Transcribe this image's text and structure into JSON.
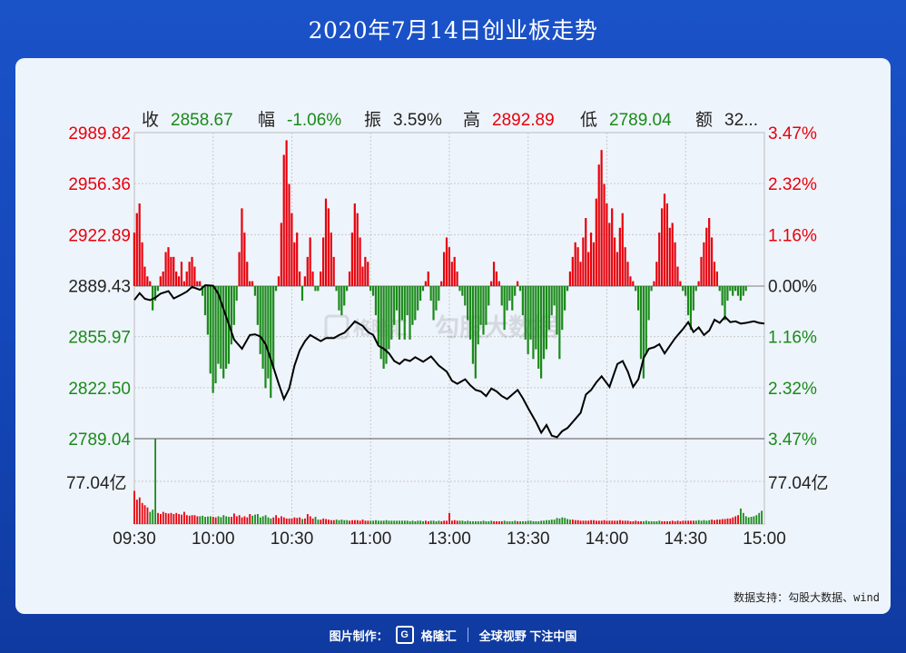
{
  "header": {
    "title": "2020年7月14日创业板走势"
  },
  "stats": {
    "close_label": "收",
    "close_value": "2858.67",
    "change_label": "幅",
    "change_value": "-1.06%",
    "amplitude_label": "振",
    "amplitude_value": "3.59%",
    "high_label": "高",
    "high_value": "2892.89",
    "low_label": "低",
    "low_value": "2789.04",
    "amount_label": "额",
    "amount_value": "32..."
  },
  "watermark": {
    "logo_text": "格隆汇",
    "text": "勾股大数据"
  },
  "source_note": "数据支持：勾股大数据、wind",
  "footer": {
    "made_by": "图片制作：",
    "logo_text": "格隆汇",
    "slogan": "全球视野 下注中国"
  },
  "colors": {
    "up": "#e8000b",
    "down": "#1a8a1a",
    "neutral": "#222222",
    "grid": "#c9c9c9"
  },
  "chart_data": {
    "type": "line",
    "prev_close": 2889.43,
    "price_ticks": [
      "2989.82",
      "2956.36",
      "2922.89",
      "2889.43",
      "2855.97",
      "2822.50",
      "2789.04"
    ],
    "pct_ticks": [
      "3.47%",
      "2.32%",
      "1.16%",
      "0.00%",
      "1.16%",
      "2.32%",
      "3.47%"
    ],
    "ylim": [
      2789.04,
      2989.82
    ],
    "x_ticks": [
      "09:30",
      "10:00",
      "10:30",
      "11:00",
      "13:00",
      "13:30",
      "14:00",
      "14:30",
      "15:00"
    ],
    "x_minutes": [
      0,
      30,
      60,
      90,
      120,
      150,
      180,
      210,
      240
    ],
    "volume_label_left": "77.04亿",
    "volume_label_right": "77.04亿",
    "price_series": {
      "minutes": [
        0,
        2,
        4,
        6,
        8,
        10,
        13,
        15,
        18,
        20,
        22,
        25,
        27,
        30,
        32,
        34,
        36,
        38,
        41,
        44,
        46,
        48,
        50,
        52,
        55,
        57,
        59,
        61,
        63,
        65,
        67,
        69,
        71,
        73,
        76,
        78,
        80,
        82,
        84,
        87,
        89,
        91,
        93,
        95,
        97,
        99,
        101,
        103,
        105,
        107,
        110,
        113,
        116,
        119,
        121,
        123,
        126,
        128,
        130,
        132,
        134,
        136,
        138,
        140,
        142,
        144,
        146,
        148,
        150,
        153,
        155,
        157,
        159,
        161,
        163,
        165,
        167,
        170,
        172,
        174,
        176,
        178,
        181,
        184,
        186,
        188,
        190,
        192,
        194,
        196,
        198,
        200,
        202,
        204,
        206,
        209,
        211,
        213,
        215,
        217,
        219,
        221,
        223,
        225,
        227,
        229,
        231,
        233,
        236,
        238,
        240
      ],
      "values": [
        2880.0,
        2884.5,
        2880.8,
        2879.9,
        2881.5,
        2884.2,
        2885.8,
        2881.0,
        2883.6,
        2885.5,
        2888.6,
        2886.7,
        2889.7,
        2889.4,
        2884.0,
        2874.0,
        2864.0,
        2854.0,
        2848.0,
        2857.0,
        2857.5,
        2856.0,
        2851.0,
        2841.0,
        2825.0,
        2815.0,
        2822.0,
        2837.0,
        2847.0,
        2853.0,
        2857.0,
        2855.0,
        2853.0,
        2855.0,
        2855.0,
        2857.0,
        2858.5,
        2862.0,
        2866.0,
        2863.0,
        2859.0,
        2857.0,
        2850.0,
        2848.0,
        2845.0,
        2840.0,
        2838.0,
        2841.0,
        2840.0,
        2842.5,
        2839.5,
        2843.0,
        2837.0,
        2833.0,
        2827.0,
        2825.0,
        2828.0,
        2824.0,
        2821.0,
        2820.0,
        2817.0,
        2822.0,
        2820.0,
        2817.0,
        2815.0,
        2818.0,
        2821.0,
        2815.5,
        2809.0,
        2800.0,
        2793.0,
        2798.0,
        2791.0,
        2790.0,
        2794.0,
        2796.0,
        2800.0,
        2806.0,
        2818.0,
        2821.0,
        2826.0,
        2830.0,
        2823.0,
        2838.0,
        2840.0,
        2833.0,
        2823.0,
        2828.0,
        2842.0,
        2848.0,
        2849.0,
        2851.0,
        2845.0,
        2850.0,
        2855.0,
        2861.0,
        2865.5,
        2859.0,
        2862.0,
        2857.0,
        2860.0,
        2867.0,
        2865.0,
        2869.0,
        2865.5,
        2866.0,
        2864.5,
        2865.0,
        2866.0,
        2865.0,
        2864.5
      ]
    },
    "breadth_series": {
      "minutes": [
        0,
        1,
        2,
        3,
        4,
        5,
        6,
        7,
        8,
        9,
        10,
        11,
        12,
        13,
        14,
        15,
        16,
        17,
        18,
        19,
        20,
        21,
        22,
        23,
        24,
        25,
        26,
        27,
        28,
        29,
        30,
        31,
        32,
        33,
        34,
        35,
        36,
        37,
        38,
        39,
        40,
        41,
        42,
        43,
        44,
        45,
        46,
        47,
        48,
        49,
        50,
        51,
        52,
        53,
        54,
        55,
        56,
        57,
        58,
        59,
        60,
        61,
        62,
        63,
        64,
        65,
        66,
        67,
        68,
        69,
        70,
        71,
        72,
        73,
        74,
        75,
        76,
        77,
        78,
        79,
        80,
        81,
        82,
        83,
        84,
        85,
        86,
        87,
        88,
        89,
        90,
        91,
        92,
        93,
        94,
        95,
        96,
        97,
        98,
        99,
        100,
        101,
        102,
        103,
        104,
        105,
        106,
        107,
        108,
        109,
        110,
        111,
        112,
        113,
        114,
        115,
        116,
        117,
        118,
        119,
        120,
        121,
        122,
        123,
        124,
        125,
        126,
        127,
        128,
        129,
        130,
        131,
        132,
        133,
        134,
        135,
        136,
        137,
        138,
        139,
        140,
        141,
        142,
        143,
        144,
        145,
        146,
        147,
        148,
        149,
        150,
        151,
        152,
        153,
        154,
        155,
        156,
        157,
        158,
        159,
        160,
        161,
        162,
        163,
        164,
        165,
        166,
        167,
        168,
        169,
        170,
        171,
        172,
        173,
        174,
        175,
        176,
        177,
        178,
        179,
        180,
        181,
        182,
        183,
        184,
        185,
        186,
        187,
        188,
        189,
        190,
        191,
        192,
        193,
        194,
        195,
        196,
        197,
        198,
        199,
        200,
        201,
        202,
        203,
        204,
        205,
        206,
        207,
        208,
        209,
        210,
        211,
        212,
        213,
        214,
        215,
        216,
        217,
        218,
        219,
        220,
        221,
        222,
        223,
        224,
        225,
        226,
        227,
        228,
        229,
        230,
        231,
        232,
        233,
        234,
        235,
        236,
        237,
        238,
        239
      ],
      "values": [
        0.55,
        0.75,
        0.85,
        0.45,
        0.2,
        0.1,
        0.05,
        -0.25,
        -0.15,
        -0.05,
        0.1,
        0.15,
        0.35,
        0.4,
        0.3,
        0.3,
        0.15,
        0.1,
        0.25,
        0.05,
        0.15,
        0.25,
        0.3,
        0.2,
        0.05,
        0.05,
        -0.1,
        -0.3,
        -0.5,
        -0.9,
        -1.1,
        -1.0,
        -0.8,
        -0.85,
        -0.95,
        -0.85,
        -0.8,
        -0.6,
        -0.4,
        -0.15,
        0.35,
        0.8,
        0.55,
        0.25,
        0.05,
        0.05,
        -0.1,
        -0.4,
        -0.7,
        -0.85,
        -1.05,
        -0.95,
        -1.15,
        -0.85,
        -0.05,
        0.1,
        0.65,
        1.35,
        1.5,
        1.05,
        0.75,
        0.45,
        0.55,
        0.15,
        -0.15,
        0.1,
        0.3,
        0.5,
        0.15,
        -0.05,
        -0.05,
        0.15,
        0.5,
        0.9,
        0.8,
        0.55,
        0.3,
        -0.05,
        -0.25,
        -0.3,
        -0.2,
        -0.05,
        0.15,
        0.55,
        0.85,
        0.75,
        0.5,
        0.2,
        0.3,
        0.25,
        -0.05,
        -0.1,
        -0.3,
        -0.6,
        -0.75,
        -0.85,
        -0.8,
        -0.65,
        -0.55,
        -0.4,
        -0.25,
        -0.55,
        -0.35,
        -0.55,
        -0.3,
        -0.55,
        -0.4,
        -0.35,
        -0.25,
        -0.15,
        -0.05,
        0.05,
        0.15,
        -0.15,
        -0.35,
        -0.25,
        -0.15,
        0.05,
        0.35,
        0.5,
        0.4,
        0.25,
        0.3,
        0.15,
        -0.05,
        -0.1,
        -0.2,
        -0.35,
        -0.55,
        -0.8,
        -0.95,
        -0.6,
        -0.4,
        -0.5,
        -0.4,
        -0.2,
        0.05,
        0.25,
        0.15,
        0.05,
        -0.2,
        -0.45,
        -0.25,
        -0.15,
        -0.25,
        -0.1,
        0.05,
        -0.05,
        -0.3,
        -0.55,
        -0.7,
        -0.55,
        -0.75,
        -0.65,
        -0.85,
        -0.95,
        -0.75,
        -0.65,
        -0.45,
        -0.3,
        -0.2,
        -0.5,
        -0.75,
        -0.45,
        -0.25,
        -0.05,
        0.15,
        0.3,
        0.45,
        0.4,
        0.25,
        0.5,
        0.7,
        0.35,
        0.55,
        0.45,
        0.9,
        1.25,
        1.4,
        1.05,
        0.85,
        0.65,
        0.8,
        0.5,
        0.35,
        0.6,
        0.75,
        0.4,
        0.25,
        0.1,
        0.05,
        -0.05,
        -0.25,
        -0.75,
        -0.95,
        -0.7,
        -0.35,
        -0.05,
        0.05,
        0.25,
        0.55,
        0.8,
        0.95,
        0.85,
        0.6,
        0.65,
        0.45,
        0.2,
        0.05,
        -0.05,
        -0.1,
        -0.3,
        -0.45,
        -0.25,
        -0.05,
        0.05,
        0.3,
        0.45,
        0.6,
        0.7,
        0.5,
        0.25,
        0.15,
        -0.05,
        -0.2,
        -0.35,
        -0.15,
        -0.05,
        -0.1,
        -0.05,
        -0.1,
        -0.15,
        -0.1,
        -0.05
      ]
    },
    "volume_series": {
      "unit": "亿",
      "max": 77.04,
      "values": [
        30.0,
        22.0,
        24.0,
        19.0,
        17.0,
        15.0,
        11.0,
        13.0,
        77.0,
        10.0,
        9.0,
        11.0,
        10.0,
        9.5,
        10.0,
        9.0,
        10.0,
        9.0,
        8.5,
        11.0,
        8.0,
        7.5,
        8.0,
        8.0,
        7.0,
        7.0,
        7.5,
        6.5,
        6.8,
        7.0,
        6.5,
        6.0,
        7.0,
        6.2,
        8.0,
        7.0,
        6.5,
        6.5,
        9.5,
        7.0,
        8.0,
        6.0,
        7.0,
        6.0,
        9.0,
        7.5,
        8.5,
        9.0,
        6.0,
        7.0,
        8.0,
        6.0,
        5.0,
        6.0,
        8.0,
        5.5,
        7.0,
        6.0,
        5.0,
        5.0,
        5.0,
        6.0,
        5.5,
        6.0,
        4.5,
        5.0,
        9.0,
        7.0,
        5.0,
        6.5,
        4.0,
        4.0,
        5.0,
        4.5,
        4.0,
        3.5,
        3.5,
        4.0,
        3.5,
        4.0,
        3.5,
        3.5,
        3.0,
        3.5,
        3.5,
        3.5,
        3.0,
        4.0,
        3.0,
        3.0,
        3.0,
        3.0,
        3.5,
        3.0,
        3.0,
        3.0,
        3.5,
        3.0,
        3.0,
        3.0,
        3.0,
        3.0,
        3.0,
        3.0,
        3.0,
        2.5,
        3.0,
        2.5,
        3.0,
        3.0,
        2.5,
        3.0,
        2.5,
        3.0,
        3.0,
        2.5,
        3.0,
        2.5,
        3.0,
        3.0,
        10.0,
        3.0,
        3.5,
        3.0,
        3.0,
        3.0,
        2.5,
        3.0,
        2.5,
        2.5,
        2.5,
        2.5,
        2.5,
        3.0,
        2.5,
        2.5,
        3.0,
        2.5,
        2.5,
        2.5,
        2.5,
        3.0,
        2.5,
        2.5,
        2.5,
        3.0,
        2.5,
        2.5,
        2.5,
        2.5,
        3.0,
        3.0,
        2.5,
        2.5,
        2.5,
        3.0,
        3.0,
        3.5,
        3.5,
        4.0,
        4.0,
        5.5,
        5.0,
        6.0,
        5.5,
        4.5,
        4.0,
        4.0,
        3.5,
        3.5,
        3.0,
        3.0,
        3.0,
        3.0,
        3.5,
        3.5,
        3.0,
        3.0,
        3.0,
        3.5,
        3.0,
        3.0,
        3.0,
        3.0,
        3.0,
        3.5,
        3.0,
        3.0,
        3.0,
        2.5,
        2.5,
        3.0,
        2.5,
        2.5,
        2.5,
        3.0,
        2.5,
        2.5,
        2.5,
        2.5,
        3.0,
        2.5,
        2.5,
        2.5,
        2.5,
        3.0,
        2.5,
        3.0,
        2.5,
        3.0,
        3.0,
        3.0,
        3.0,
        3.0,
        3.0,
        3.5,
        3.0,
        3.5,
        3.0,
        3.5,
        4.0,
        3.5,
        4.0,
        4.0,
        4.5,
        4.5,
        5.0,
        5.0,
        6.0,
        7.0,
        8.0,
        14.0,
        10.0,
        7.0,
        6.0,
        6.5,
        7.0,
        8.0,
        10.0,
        12.0
      ],
      "colors_up": [
        1,
        1,
        1,
        1,
        1,
        1,
        0,
        0,
        0,
        1,
        1,
        1,
        1,
        1,
        1,
        1,
        1,
        1,
        1,
        1,
        1,
        1,
        1,
        1,
        1,
        0,
        0,
        0,
        0,
        0,
        1,
        1,
        0,
        0,
        0,
        0,
        0,
        1,
        1,
        1,
        1,
        1,
        1,
        1,
        1,
        0,
        0,
        0,
        0,
        0,
        0,
        0,
        0,
        1,
        1,
        1,
        1,
        1,
        1,
        1,
        1,
        1,
        1,
        1,
        0,
        1,
        1,
        1,
        1,
        0,
        0,
        1,
        1,
        1,
        1,
        1,
        1,
        0,
        0,
        0,
        0,
        0,
        1,
        1,
        1,
        1,
        1,
        1,
        1,
        1,
        0,
        0,
        0,
        0,
        0,
        0,
        0,
        0,
        0,
        0,
        0,
        0,
        0,
        0,
        0,
        0,
        0,
        0,
        0,
        0,
        0,
        1,
        1,
        0,
        0,
        0,
        0,
        1,
        1,
        1,
        1,
        1,
        1,
        1,
        0,
        0,
        0,
        0,
        0,
        0,
        0,
        0,
        0,
        0,
        0,
        0,
        0,
        1,
        1,
        1,
        1,
        0,
        0,
        0,
        0,
        0,
        1,
        0,
        0,
        0,
        0,
        0,
        0,
        0,
        0,
        0,
        0,
        0,
        0,
        0,
        0,
        0,
        0,
        0,
        0,
        0,
        0,
        1,
        1,
        1,
        1,
        1,
        1,
        1,
        1,
        1,
        1,
        1,
        1,
        1,
        1,
        1,
        1,
        1,
        1,
        1,
        1,
        1,
        1,
        1,
        1,
        1,
        1,
        1,
        0,
        0,
        0,
        0,
        0,
        0,
        0,
        1,
        1,
        1,
        1,
        1,
        1,
        1,
        1,
        1,
        1,
        1,
        1,
        1,
        0,
        0,
        0,
        0,
        0,
        0,
        1,
        1,
        1,
        1,
        1,
        1,
        1,
        1,
        1,
        1,
        1,
        0,
        0,
        0,
        0,
        0,
        0,
        0,
        0,
        0,
        0,
        0
      ]
    }
  }
}
